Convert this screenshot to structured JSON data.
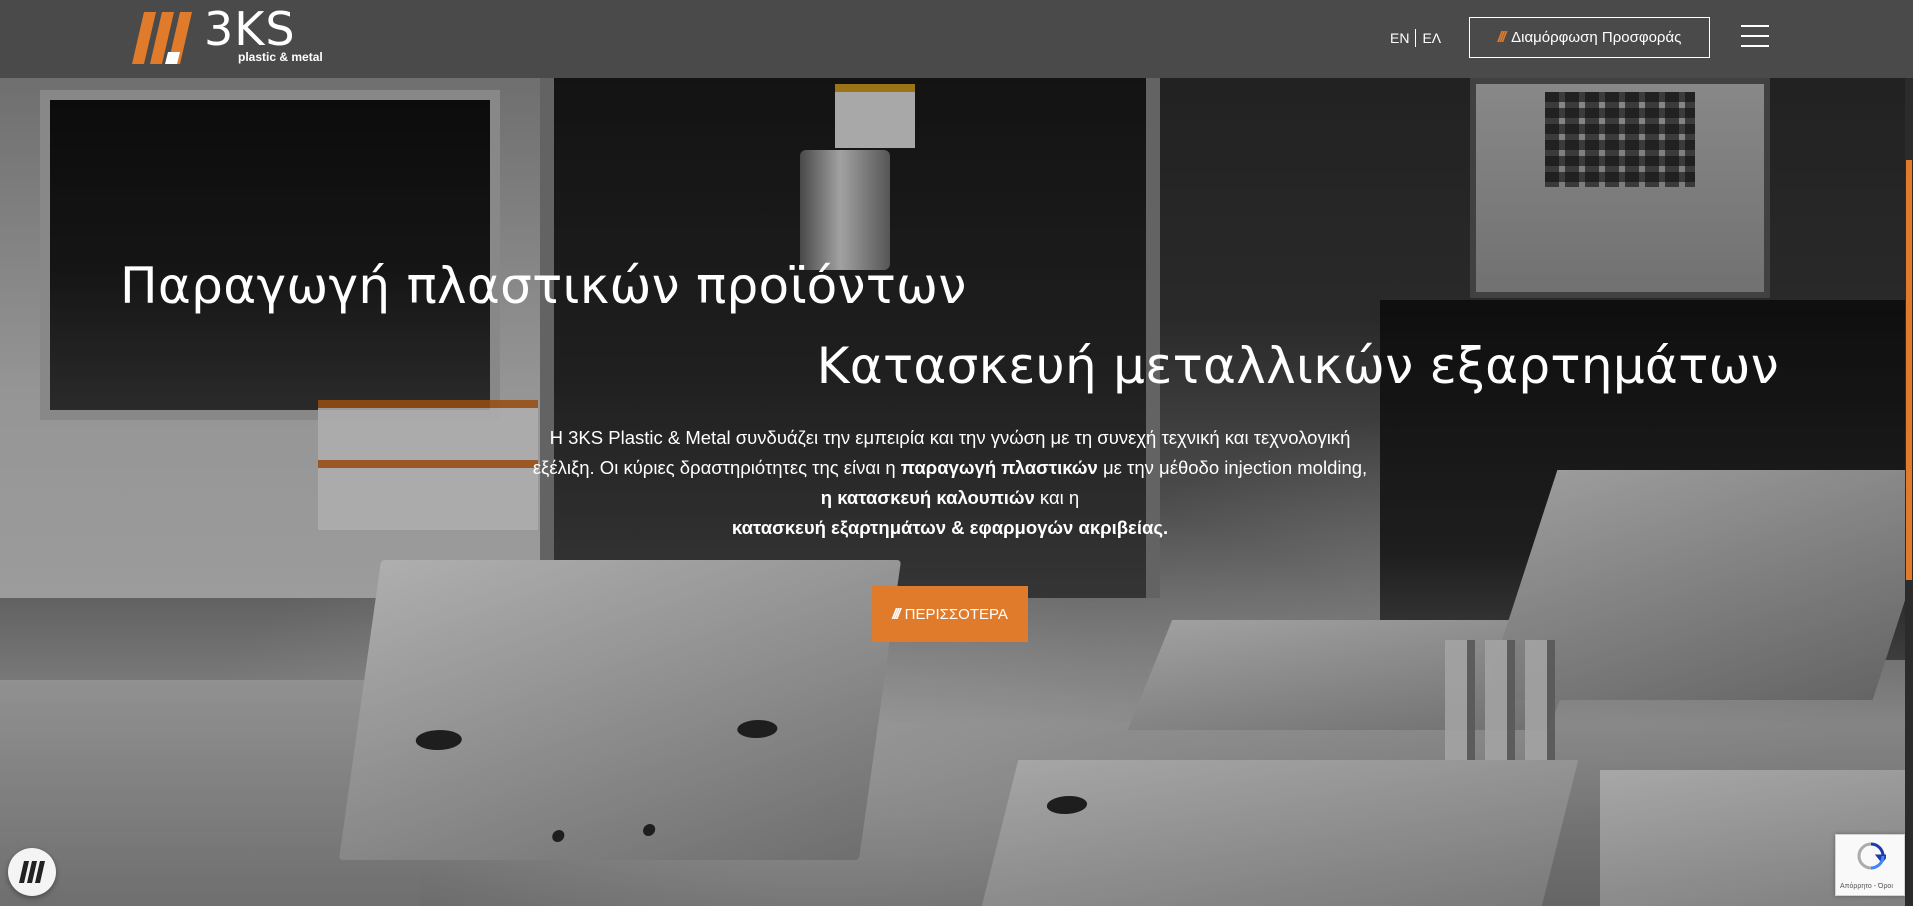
{
  "header": {
    "logo_text": "3KS",
    "logo_tagline": "plastic & metal",
    "lang_en": "EN",
    "lang_el": "ΕΛ",
    "offer_button_label": "Διαμόρφωση Προσφοράς",
    "menu_icon": "hamburger-icon"
  },
  "hero": {
    "headline_1": "Παραγωγή πλαστικών προϊόντων",
    "headline_2": "Κατασκευή μεταλλικών εξαρτημάτων",
    "intro_part_1": "Η 3KS Plastic & Metal συνδυάζει την εμπειρία και την γνώση με τη συνεχή τεχνική και τεχνολογική εξέλιξη. Οι κύριες δραστηριότητες της είναι η ",
    "intro_bold_1": "παραγωγή πλαστικών",
    "intro_part_2": " με την μέθοδο injection molding, ",
    "intro_bold_2": "η κατασκευή καλουπιών",
    "intro_part_3": " και η ",
    "intro_bold_3": "κατασκευή εξαρτημάτων & εφαρμογών ακριβείας.",
    "more_button_label": "ΠΕΡΙΣΣΟΤΕΡΑ"
  },
  "widgets": {
    "chat_icon": "brand-slashes-icon",
    "recaptcha_text": "Απόρρητο - Όροι"
  },
  "colors": {
    "accent": "#e07b2b",
    "header_bg": "#4a4a4a",
    "text": "#ffffff"
  }
}
